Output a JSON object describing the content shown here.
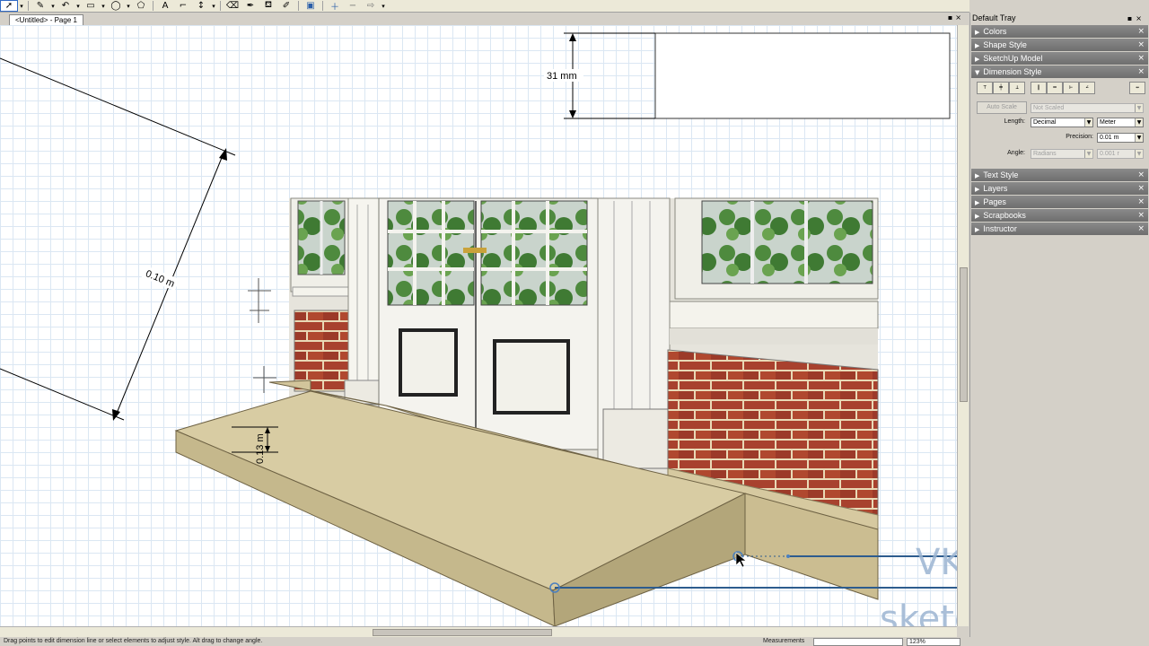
{
  "toolbar": {
    "icons": [
      "select-icon",
      "pencil-icon",
      "arc-icon",
      "rectangle-icon",
      "circle-icon",
      "polygon-icon",
      "text-icon",
      "label-icon",
      "dimension-icon",
      "eraser-icon",
      "eyedropper-icon",
      "paint-bucket-icon",
      "style-painter-icon",
      "presentation-icon",
      "add-page-icon",
      "remove-page-icon",
      "next-page-icon"
    ],
    "glyphs": [
      "➚",
      "✎",
      "↶",
      "▭",
      "◯",
      "⬠",
      "A",
      "⌐",
      "↕",
      "⌫",
      "✒",
      "⛾",
      "✐",
      "▣",
      "＋",
      "−",
      "⇨"
    ]
  },
  "document": {
    "tab_label": "<Untitled> - Page 1"
  },
  "canvas": {
    "dimension_top": "31 mm",
    "dimension_diagonal": "0.10 m",
    "dimension_step": "0.13 m"
  },
  "watermark": {
    "line1": "VK.COM/",
    "line2": "sketchup_ru"
  },
  "tray": {
    "title": "Default Tray",
    "panels_top": [
      "Colors",
      "Shape Style",
      "SketchUp Model"
    ],
    "open_panel": "Dimension Style",
    "panels_bottom": [
      "Text Style",
      "Layers",
      "Pages",
      "Scrapbooks",
      "Instructor"
    ],
    "dimension_style": {
      "auto_scale_label": "Auto Scale",
      "scale_value": "Not Scaled",
      "length_label": "Length:",
      "length_format": "Decimal",
      "length_unit": "Meter",
      "precision_label": "Precision:",
      "precision_value": "0.01 m",
      "angle_label": "Angle:",
      "angle_unit": "Radians",
      "angle_precision": "0.001 r"
    }
  },
  "status": {
    "message": "Drag points to edit dimension line or select elements to adjust style. Alt drag to change angle.",
    "measurements_label": "Measurements",
    "zoom": "123%"
  }
}
